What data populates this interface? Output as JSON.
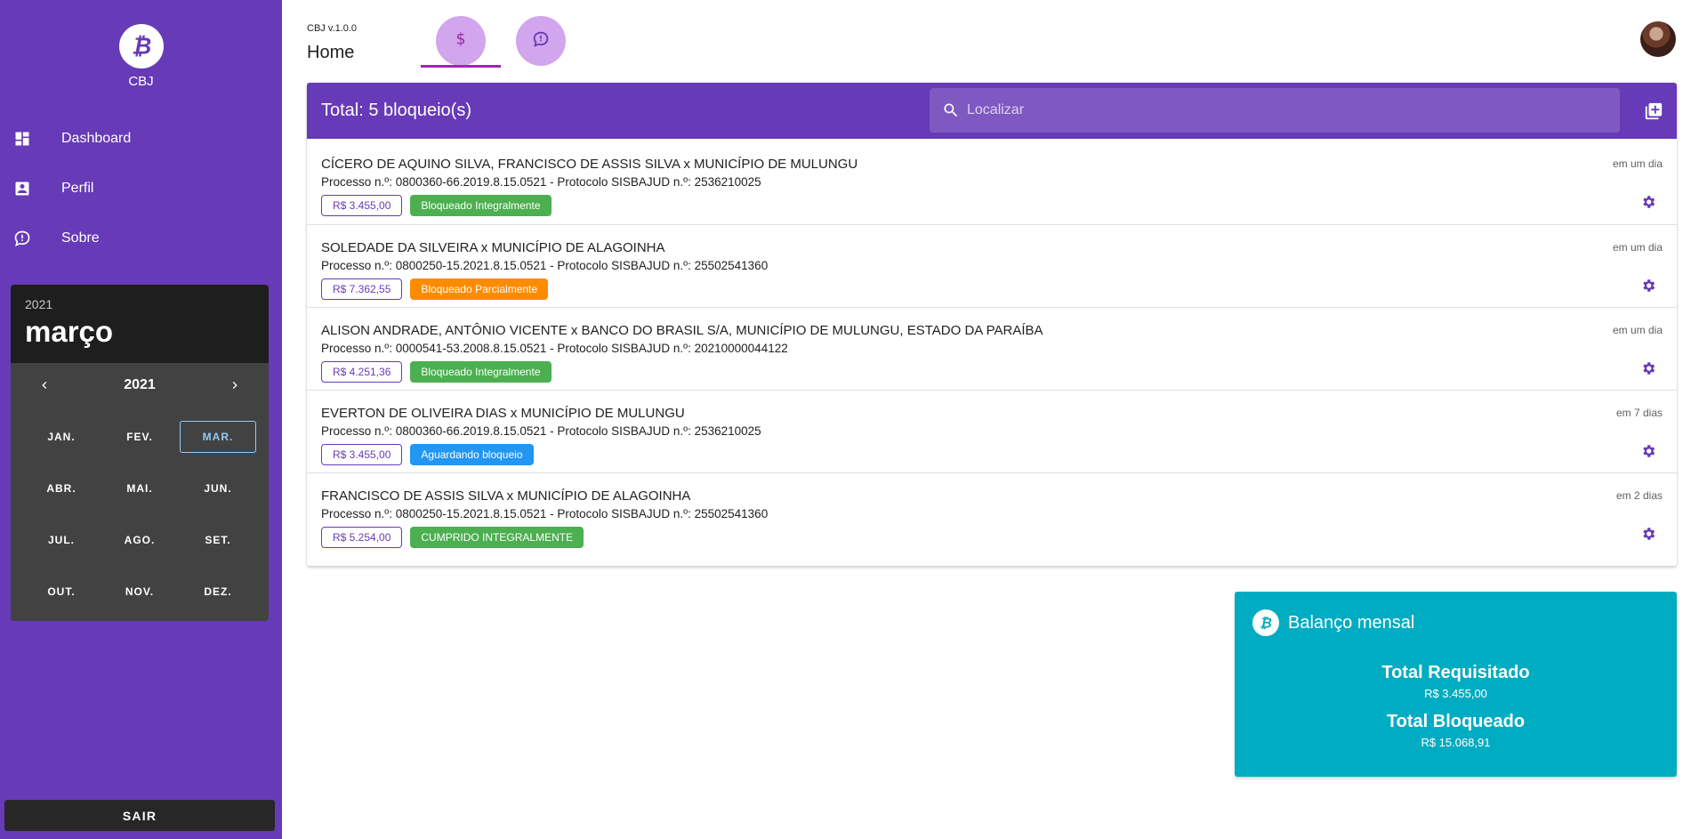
{
  "app": {
    "name": "CBJ",
    "version": "CBJ v.1.0.0",
    "page_title": "Home"
  },
  "sidebar": {
    "items": [
      {
        "label": "Dashboard",
        "icon": "dashboard-icon"
      },
      {
        "label": "Perfil",
        "icon": "account-box-icon"
      },
      {
        "label": "Sobre",
        "icon": "feedback-icon"
      }
    ],
    "logout_label": "SAIR"
  },
  "calendar": {
    "header_year": "2021",
    "header_month": "março",
    "nav_year": "2021",
    "months": [
      "JAN.",
      "FEV.",
      "MAR.",
      "ABR.",
      "MAI.",
      "JUN.",
      "JUL.",
      "AGO.",
      "SET.",
      "OUT.",
      "NOV.",
      "DEZ."
    ],
    "selected_month": "MAR."
  },
  "tabs": [
    {
      "icon": "dollar-icon",
      "active": true
    },
    {
      "icon": "feedback-icon",
      "active": false
    }
  ],
  "list": {
    "title": "Total: 5 bloqueio(s)",
    "search_placeholder": "Localizar",
    "rows": [
      {
        "title": "CÍCERO DE AQUINO SILVA, FRANCISCO DE ASSIS SILVA x MUNICÍPIO DE MULUNGU",
        "subtitle": "Processo n.º: 0800360-66.2019.8.15.0521 - Protocolo SISBAJUD n.º: 2536210025",
        "value": "R$ 3.455,00",
        "status": "Bloqueado Integralmente",
        "status_color": "#4caf50",
        "time": "em um dia"
      },
      {
        "title": "SOLEDADE DA SILVEIRA x MUNICÍPIO DE ALAGOINHA",
        "subtitle": "Processo n.º: 0800250-15.2021.8.15.0521 - Protocolo SISBAJUD n.º: 25502541360",
        "value": "R$ 7.362,55",
        "status": "Bloqueado Parcialmente",
        "status_color": "#fb8c00",
        "time": "em um dia"
      },
      {
        "title": "ALISON ANDRADE, ANTÔNIO VICENTE x BANCO DO BRASIL S/A, MUNICÍPIO DE MULUNGU, ESTADO DA PARAÍBA",
        "subtitle": "Processo n.º: 0000541-53.2008.8.15.0521 - Protocolo SISBAJUD n.º: 20210000044122",
        "value": "R$ 4.251,36",
        "status": "Bloqueado Integralmente",
        "status_color": "#4caf50",
        "time": "em um dia"
      },
      {
        "title": "EVERTON DE OLIVEIRA DIAS x MUNICÍPIO DE MULUNGU",
        "subtitle": "Processo n.º: 0800360-66.2019.8.15.0521 - Protocolo SISBAJUD n.º: 2536210025",
        "value": "R$ 3.455,00",
        "status": "Aguardando bloqueio",
        "status_color": "#2196f3",
        "time": "em 7 dias"
      },
      {
        "title": "FRANCISCO DE ASSIS SILVA x MUNICÍPIO DE ALAGOINHA",
        "subtitle": "Processo n.º: 0800250-15.2021.8.15.0521 - Protocolo SISBAJUD n.º: 25502541360",
        "value": "R$ 5.254,00",
        "status": "CUMPRIDO INTEGRALMENTE",
        "status_color": "#4caf50",
        "time": "em 2 dias"
      }
    ]
  },
  "balance": {
    "title": "Balanço mensal",
    "requested_label": "Total Requisitado",
    "requested_value": "R$ 3.455,00",
    "blocked_label": "Total Bloqueado",
    "blocked_value": "R$ 15.068,91"
  },
  "colors": {
    "primary": "#673ab7",
    "accent": "#9c27b0",
    "balance": "#00acc1",
    "calendar_dark": "#424242"
  }
}
